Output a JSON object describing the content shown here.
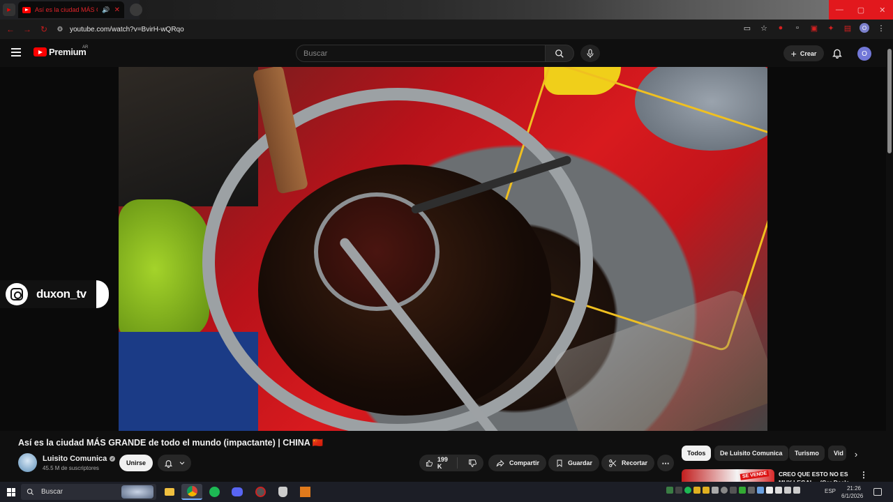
{
  "browser": {
    "tab_title": "Así es la ciudad MÁS GRAN",
    "tab_speaker_icon": "speaker-icon",
    "tab_close": "✕",
    "url": "youtube.com/watch?v=BvirH-wQRqo"
  },
  "header": {
    "logo_text": "Premium",
    "logo_country": "AR",
    "search_placeholder": "Buscar",
    "create_label": "Crear",
    "avatar_letter": "O"
  },
  "overlay": {
    "instagram_handle": "duxon_tv"
  },
  "video": {
    "title": "Así es la ciudad MÁS GRANDE de todo el mundo (impactante) | CHINA 🇨🇳",
    "channel_name": "Luisito Comunica",
    "subscribers": "45.5 M de suscriptores",
    "join_label": "Unirse",
    "likes": "199 K",
    "share_label": "Compartir",
    "save_label": "Guardar",
    "clip_label": "Recortar",
    "more_label": "⋯"
  },
  "chips": [
    "Todos",
    "De Luisito Comunica",
    "Turismo",
    "Vid"
  ],
  "recommendation": {
    "title": "CREO QUE ESTO NO ES MUY LEGAL... (Car Deals",
    "thumb_tag": "SE VENDE"
  },
  "taskbar": {
    "search_placeholder": "Buscar",
    "language": "ESP",
    "time": "21:26",
    "date": "6/1/2026"
  },
  "colors": {
    "youtube_red": "#ff0000",
    "accent_avatar": "#7278d8",
    "background": "#0f0f0f"
  }
}
